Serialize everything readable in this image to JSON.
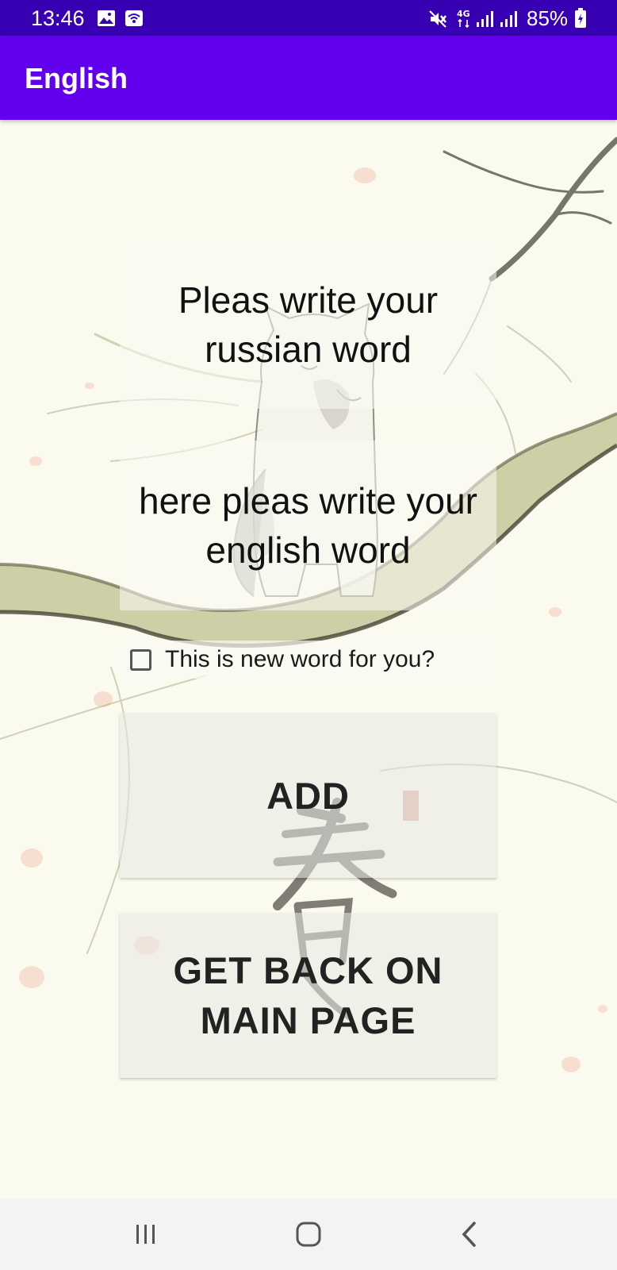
{
  "status_bar": {
    "time": "13:46",
    "battery": "85%",
    "icons": [
      "image-icon",
      "wifi-icon",
      "mute-icon",
      "4g-icon",
      "signal-icon",
      "signal-icon",
      "battery-charging-icon"
    ]
  },
  "app_bar": {
    "title": "English"
  },
  "form": {
    "russian_field_hint": "Pleas write your russian word",
    "english_field_hint": "here pleas write your english word",
    "new_word_checkbox_label": "This is new word for you?",
    "new_word_checked": false
  },
  "buttons": {
    "add_label": "ADD",
    "back_label": "GET BACK ON MAIN PAGE"
  },
  "nav_bar": {
    "icons": [
      "recent-apps-icon",
      "home-icon",
      "back-icon"
    ]
  },
  "colors": {
    "status_bar": "#3700b3",
    "app_bar": "#6200ee",
    "background": "#fbfaee"
  }
}
